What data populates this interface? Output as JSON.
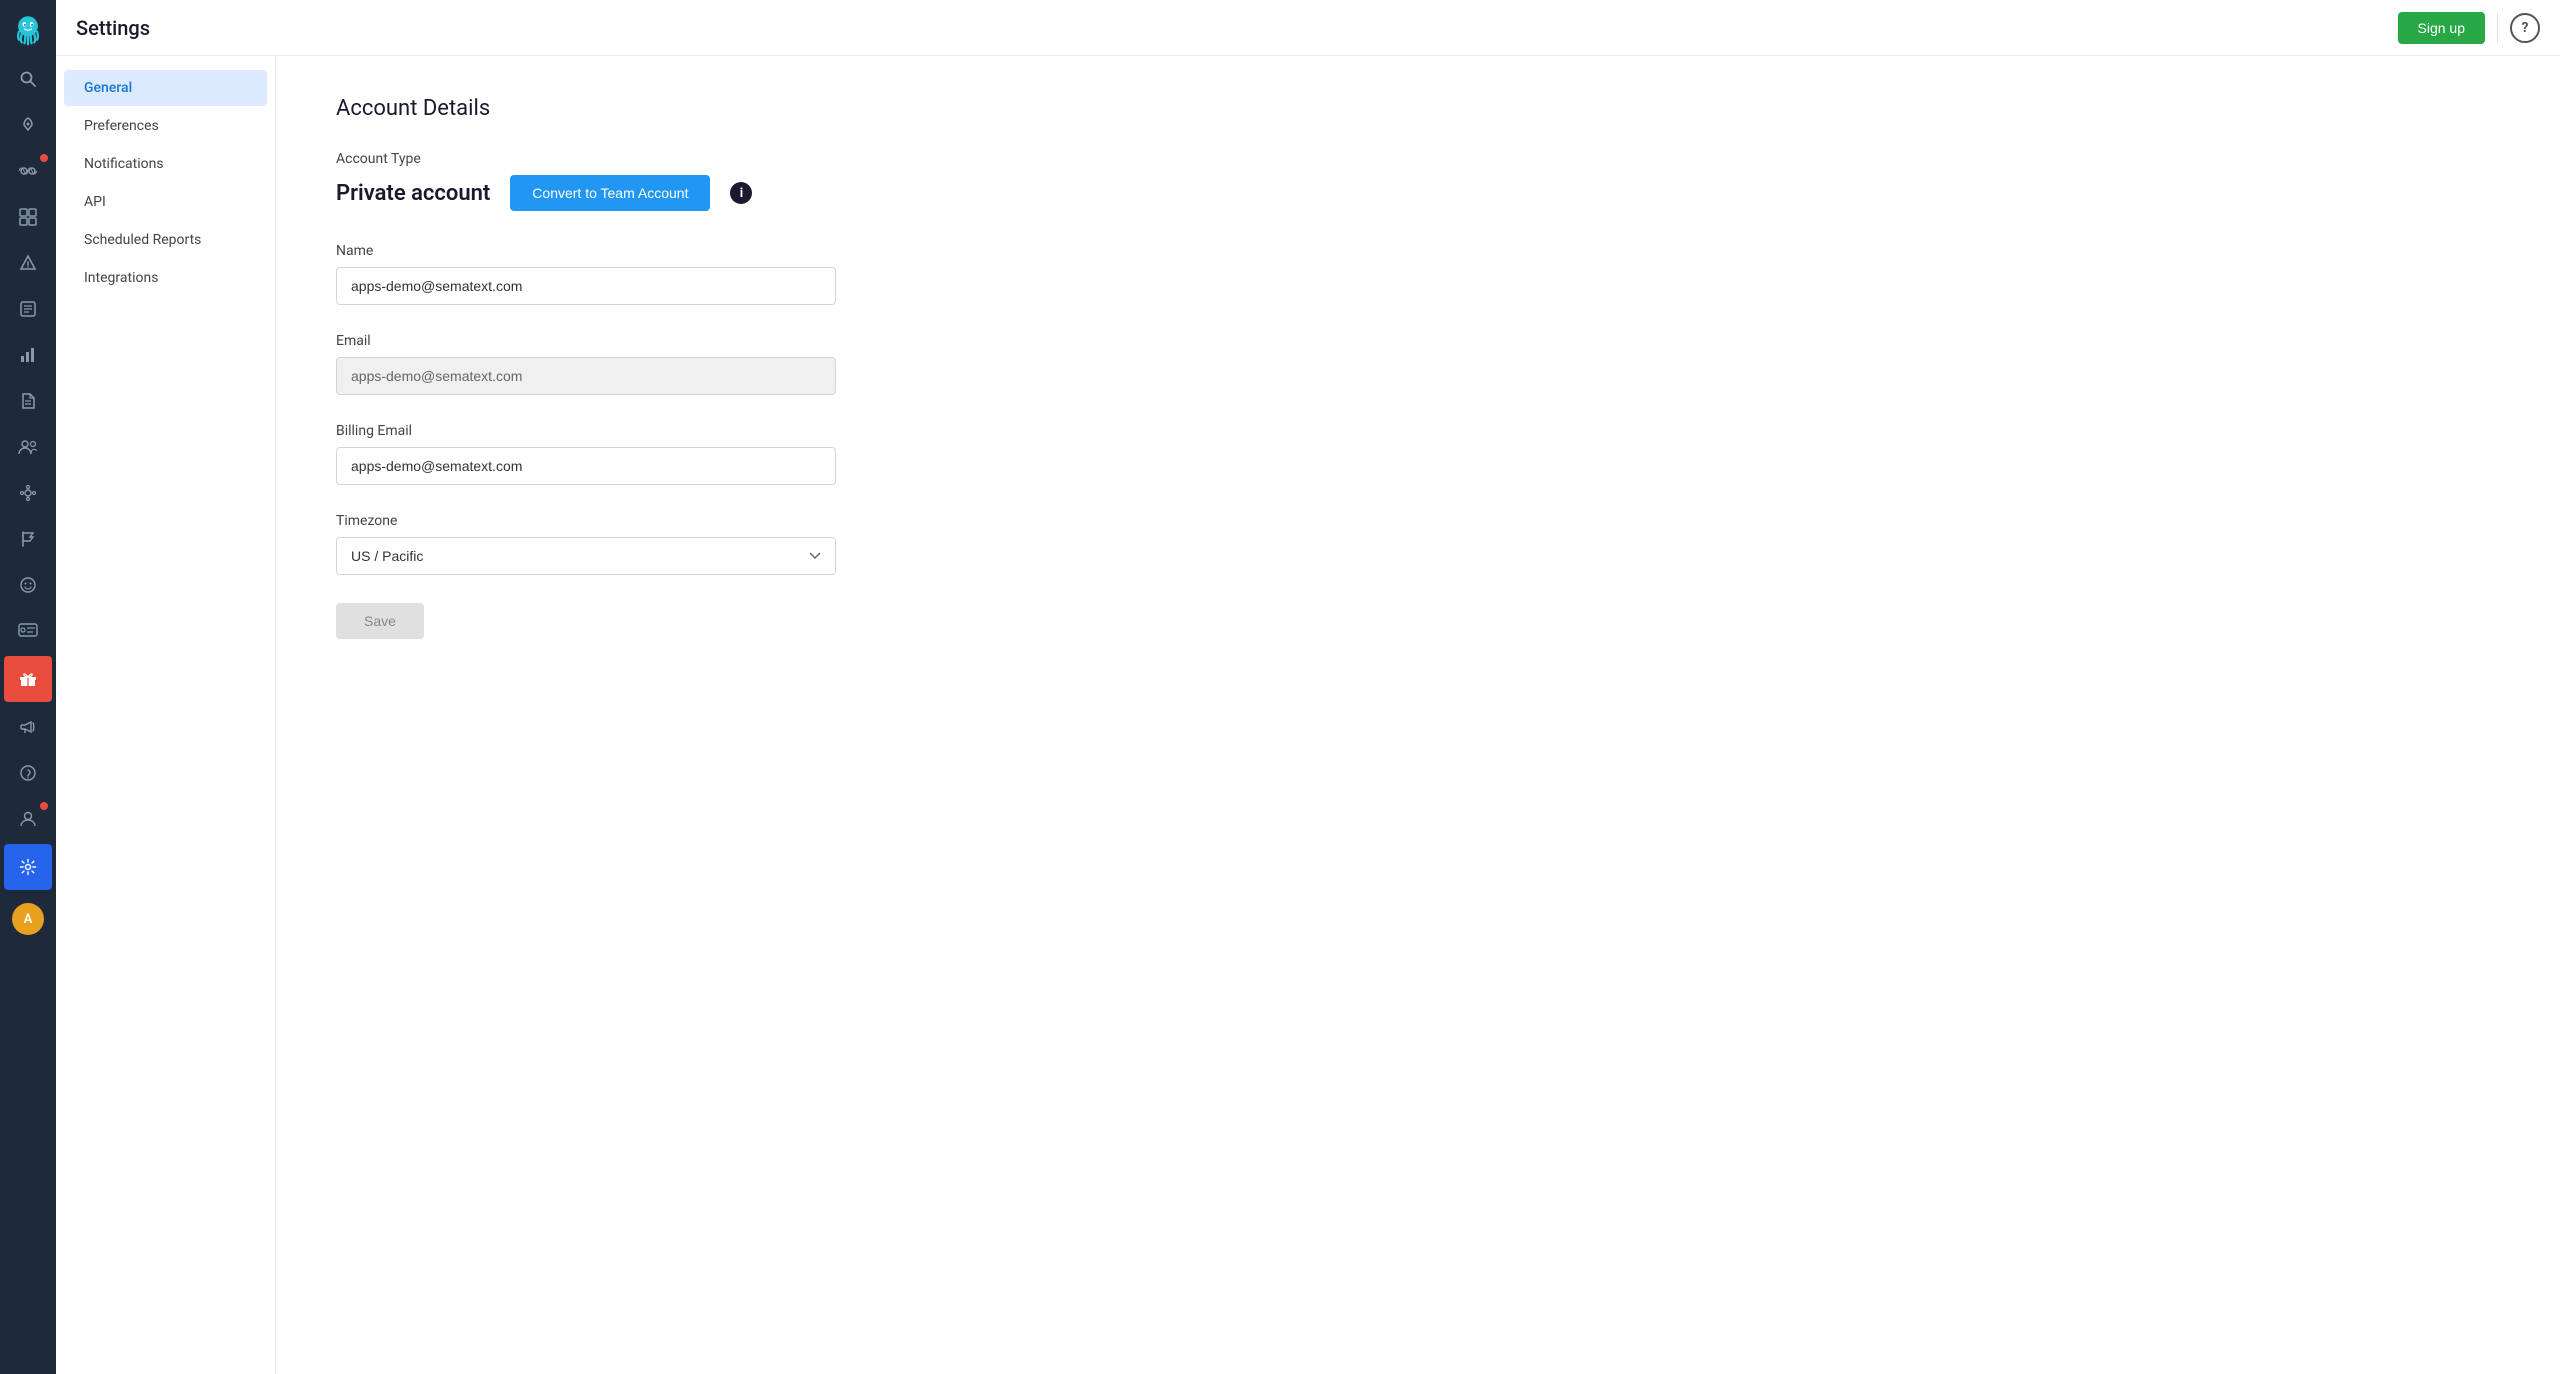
{
  "app": {
    "title": "Settings"
  },
  "header": {
    "signup_label": "Sign up",
    "help_label": "?"
  },
  "settings_sidebar": {
    "items": [
      {
        "id": "general",
        "label": "General",
        "active": true
      },
      {
        "id": "preferences",
        "label": "Preferences",
        "active": false
      },
      {
        "id": "notifications",
        "label": "Notifications",
        "active": false
      },
      {
        "id": "api",
        "label": "API",
        "active": false
      },
      {
        "id": "scheduled-reports",
        "label": "Scheduled Reports",
        "active": false
      },
      {
        "id": "integrations",
        "label": "Integrations",
        "active": false
      }
    ]
  },
  "main": {
    "section_title": "Account Details",
    "account_type_label": "Account Type",
    "account_type_value": "Private account",
    "convert_btn_label": "Convert to Team Account",
    "name_label": "Name",
    "name_value": "apps-demo@sematext.com",
    "email_label": "Email",
    "email_value": "apps-demo@sematext.com",
    "billing_email_label": "Billing Email",
    "billing_email_value": "apps-demo@sematext.com",
    "timezone_label": "Timezone",
    "timezone_value": "US / Pacific",
    "save_btn_label": "Save"
  },
  "icons": {
    "search": "🔍",
    "rocket": "🚀",
    "binoculars": "👁",
    "grid": "⊞",
    "alert": "⚠",
    "box": "📦",
    "bar_chart": "📊",
    "document": "📄",
    "users": "👥",
    "bot": "🤖",
    "flag": "🚩",
    "clock": "🕐",
    "glasses": "🕶",
    "gift": "🎁",
    "megaphone": "📣",
    "help": "❓",
    "user_admin": "👤",
    "settings": "⚙"
  }
}
